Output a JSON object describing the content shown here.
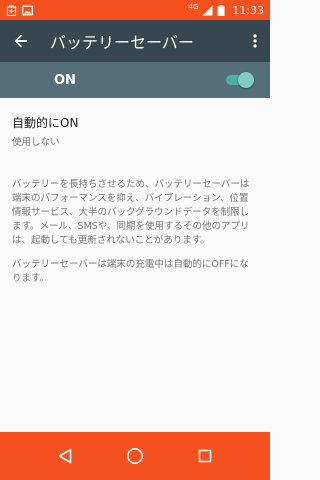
{
  "status_bar": {
    "time": "11:33",
    "network": "4G",
    "icons": [
      "battery-saver-icon",
      "image-icon",
      "signal-icon",
      "battery-icon"
    ],
    "color": "#F4511E"
  },
  "toolbar": {
    "title": "バッテリーセーバー",
    "back_icon": "arrow-back-icon",
    "more_icon": "more-vert-icon",
    "color": "#37474F"
  },
  "master_switch": {
    "label": "ON",
    "state": true,
    "color": "#546E7A",
    "accent": "#80CBC4"
  },
  "preference": {
    "title": "自動的にON",
    "summary": "使用しない"
  },
  "description": {
    "paragraph1": "バッテリーを長持ちさせるため、バッテリーセーバーは端末のパフォーマンスを抑え、バイブレーション、位置情報サービス、大半のバックグラウンドデータを制限します。メール、SMSや、同期を使用するその他のアプリは、起動しても更新されないことがあります。",
    "paragraph2": "バッテリーセーバーは端末の充電中は自動的にOFFになります。"
  },
  "nav_bar": {
    "buttons": [
      "back-triangle-icon",
      "home-circle-icon",
      "recents-square-icon"
    ],
    "color": "#F4511E"
  }
}
